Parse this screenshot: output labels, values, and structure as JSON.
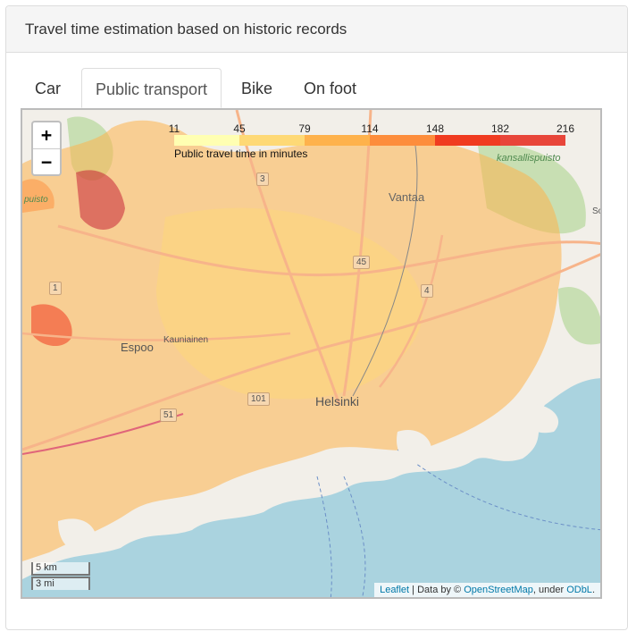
{
  "panel": {
    "title": "Travel time estimation based on historic records"
  },
  "tabs": [
    {
      "label": "Car",
      "active": false
    },
    {
      "label": "Public transport",
      "active": true
    },
    {
      "label": "Bike",
      "active": false
    },
    {
      "label": "On foot",
      "active": false
    }
  ],
  "map": {
    "zoom_in": "+",
    "zoom_out": "−",
    "legend": {
      "title": "Public travel time in minutes",
      "ticks": [
        "11",
        "45",
        "79",
        "114",
        "148",
        "182",
        "216"
      ],
      "colors": [
        "#ffffb2",
        "#fed976",
        "#feb24c",
        "#fd8d3c",
        "#f03b20",
        "#e8463a",
        "#bd0026"
      ]
    },
    "places": {
      "vantaa": "Vantaa",
      "espoo": "Espoo",
      "helsinki": "Helsinki",
      "kauniainen": "Kauniainen",
      "kansallispuisto": "kansallispuisto",
      "puisto": "puisto",
      "so": "So"
    },
    "roads": {
      "r3": "3",
      "r45": "45",
      "r4": "4",
      "r1": "1",
      "r101": "101",
      "r51": "51"
    },
    "scale": {
      "km": "5 km",
      "mi": "3 mi"
    },
    "attribution": {
      "leaflet": "Leaflet",
      "sep": " | Data by © ",
      "osm": "OpenStreetMap",
      "under": ", under ",
      "odbl": "ODbL",
      "dot": "."
    }
  }
}
